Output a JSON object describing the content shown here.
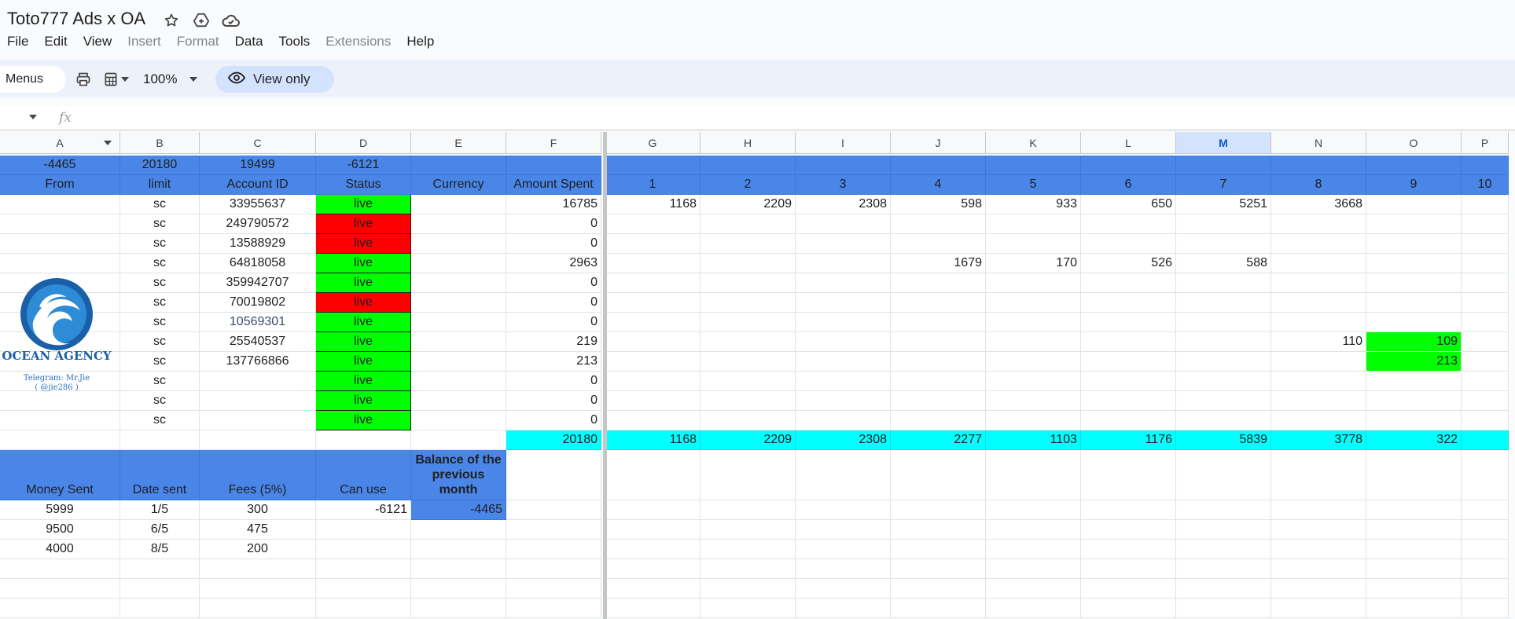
{
  "doc_title": "Toto777 Ads x OA",
  "menus": [
    {
      "label": "File",
      "enabled": true
    },
    {
      "label": "Edit",
      "enabled": true
    },
    {
      "label": "View",
      "enabled": true
    },
    {
      "label": "Insert",
      "enabled": false
    },
    {
      "label": "Format",
      "enabled": false
    },
    {
      "label": "Data",
      "enabled": true
    },
    {
      "label": "Tools",
      "enabled": true
    },
    {
      "label": "Extensions",
      "enabled": false
    },
    {
      "label": "Help",
      "enabled": true
    }
  ],
  "toolbar": {
    "menus_label": "Menus",
    "zoom": "100%",
    "view_only_label": "View only"
  },
  "formula": {
    "fx": "fx",
    "value": ""
  },
  "columns": [
    "A",
    "B",
    "C",
    "D",
    "E",
    "F",
    "G",
    "H",
    "I",
    "J",
    "K",
    "L",
    "M",
    "N",
    "O",
    "P"
  ],
  "selected_column": "M",
  "logo": {
    "name": "OCEAN AGENCY",
    "telegram": "Telegram: Mr.Jie",
    "handle": "( @jie286 )"
  },
  "colors": {
    "header_blue": "#4a86e8",
    "live_green": "#00ff00",
    "dead_red": "#ff0000",
    "total_cyan": "#00ffff"
  },
  "rows": [
    {
      "type": "summary",
      "A": "-4465",
      "B": "20180",
      "C": "19499",
      "D": "-6121",
      "E": "",
      "F": "",
      "days": [
        "",
        "",
        "",
        "",
        "",
        "",
        "",
        "",
        "",
        ""
      ]
    },
    {
      "type": "header",
      "A": "From",
      "B": "limit",
      "C": "Account ID",
      "D": "Status",
      "E": "Currency",
      "F": "Amount Spent",
      "days": [
        "1",
        "2",
        "3",
        "4",
        "5",
        "6",
        "7",
        "8",
        "9",
        "10"
      ]
    },
    {
      "type": "data",
      "B": "sc",
      "C": "33955637",
      "D": "live",
      "Dcolor": "green",
      "F": "16785",
      "days": [
        "1168",
        "2209",
        "2308",
        "598",
        "933",
        "650",
        "5251",
        "3668",
        "",
        ""
      ]
    },
    {
      "type": "data",
      "B": "sc",
      "C": "249790572",
      "D": "live",
      "Dcolor": "red",
      "F": "0",
      "days": [
        "",
        "",
        "",
        "",
        "",
        "",
        "",
        "",
        "",
        ""
      ]
    },
    {
      "type": "data",
      "B": "sc",
      "C": "13588929",
      "D": "live",
      "Dcolor": "red",
      "F": "0",
      "days": [
        "",
        "",
        "",
        "",
        "",
        "",
        "",
        "",
        "",
        ""
      ]
    },
    {
      "type": "data",
      "B": "sc",
      "C": "64818058",
      "D": "live",
      "Dcolor": "green",
      "F": "2963",
      "days": [
        "",
        "",
        "",
        "1679",
        "170",
        "526",
        "588",
        "",
        "",
        ""
      ]
    },
    {
      "type": "data",
      "B": "sc",
      "C": "359942707",
      "D": "live",
      "Dcolor": "green",
      "F": "0",
      "days": [
        "",
        "",
        "",
        "",
        "",
        "",
        "",
        "",
        "",
        ""
      ]
    },
    {
      "type": "data",
      "B": "sc",
      "C": "70019802",
      "D": "live",
      "Dcolor": "red",
      "F": "0",
      "days": [
        "",
        "",
        "",
        "",
        "",
        "",
        "",
        "",
        "",
        ""
      ]
    },
    {
      "type": "data",
      "B": "sc",
      "C": "10569301",
      "D": "live",
      "Dcolor": "green",
      "F": "0",
      "days": [
        "",
        "",
        "",
        "",
        "",
        "",
        "",
        "",
        "",
        ""
      ]
    },
    {
      "type": "data",
      "B": "sc",
      "C": "25540537",
      "D": "live",
      "Dcolor": "green",
      "F": "219",
      "days": [
        "",
        "",
        "",
        "",
        "",
        "",
        "",
        "110",
        "109",
        ""
      ]
    },
    {
      "type": "data",
      "B": "sc",
      "C": "137766866",
      "D": "live",
      "Dcolor": "green",
      "F": "213",
      "days": [
        "",
        "",
        "",
        "",
        "",
        "",
        "",
        "",
        "213",
        ""
      ]
    },
    {
      "type": "data",
      "B": "sc",
      "C": "",
      "D": "live",
      "Dcolor": "green",
      "F": "0",
      "days": [
        "",
        "",
        "",
        "",
        "",
        "",
        "",
        "",
        "",
        ""
      ]
    },
    {
      "type": "data",
      "B": "sc",
      "C": "",
      "D": "live",
      "Dcolor": "green",
      "F": "0",
      "days": [
        "",
        "",
        "",
        "",
        "",
        "",
        "",
        "",
        "",
        ""
      ]
    },
    {
      "type": "data",
      "B": "sc",
      "C": "",
      "D": "live",
      "Dcolor": "green",
      "F": "0",
      "days": [
        "",
        "",
        "",
        "",
        "",
        "",
        "",
        "",
        "",
        ""
      ]
    },
    {
      "type": "total",
      "F": "20180",
      "days": [
        "1168",
        "2209",
        "2308",
        "2277",
        "1103",
        "1176",
        "5839",
        "3778",
        "322",
        ""
      ]
    }
  ],
  "money_header": {
    "A": "Money Sent",
    "B": "Date sent",
    "C": "Fees (5%)",
    "D": "Can use",
    "E": "Balance of the previous month"
  },
  "money_rows": [
    {
      "A": "5999",
      "B": "1/5",
      "C": "300",
      "D": "-6121",
      "E": "-4465"
    },
    {
      "A": "9500",
      "B": "6/5",
      "C": "475",
      "D": "",
      "E": ""
    },
    {
      "A": "4000",
      "B": "8/5",
      "C": "200",
      "D": "",
      "E": ""
    }
  ]
}
